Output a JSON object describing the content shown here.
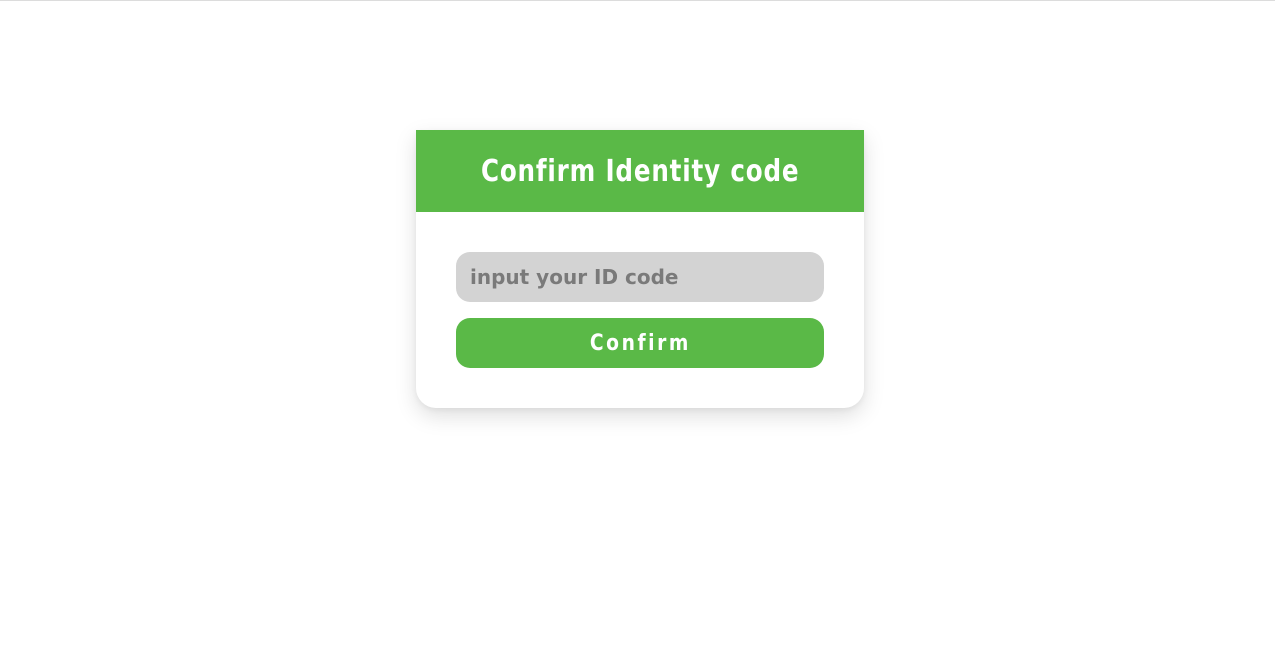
{
  "dialog": {
    "title": "Confirm Identity code",
    "input": {
      "placeholder": "input your ID code",
      "value": ""
    },
    "confirm_label": "Confirm"
  },
  "colors": {
    "accent": "#5ab947",
    "input_background": "#d3d3d3",
    "title_text": "#ffffff",
    "placeholder_text": "#7a7a7a"
  }
}
